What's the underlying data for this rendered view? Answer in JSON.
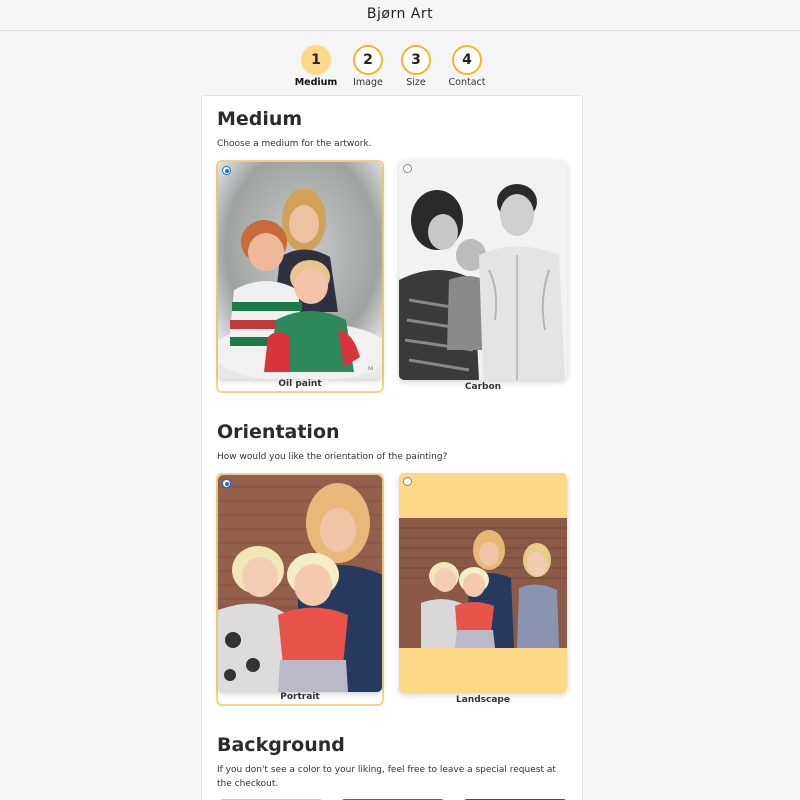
{
  "header": {
    "logo": "Bjørn Art"
  },
  "steps": [
    {
      "number": "1",
      "label": "Medium",
      "active": true
    },
    {
      "number": "2",
      "label": "Image",
      "active": false
    },
    {
      "number": "3",
      "label": "Size",
      "active": false
    },
    {
      "number": "4",
      "label": "Contact",
      "active": false
    }
  ],
  "medium": {
    "title": "Medium",
    "description": "Choose a medium for the artwork.",
    "options": [
      {
        "label": "Oil paint",
        "selected": true
      },
      {
        "label": "Carbon",
        "selected": false
      }
    ]
  },
  "orientation": {
    "title": "Orientation",
    "description": "How would you like the orientation of the painting?",
    "options": [
      {
        "label": "Portrait",
        "selected": true
      },
      {
        "label": "Landscape",
        "selected": false
      }
    ]
  },
  "background": {
    "title": "Background",
    "description": "If you don't see a color to your liking, feel free to leave a special request at the checkout.",
    "swatches": [
      "#f5c76a",
      "#2f6fb0",
      "#4a4a4a"
    ]
  },
  "colors": {
    "accent": "#f0b92b",
    "accent_light": "#fcd887",
    "selected_border": "#f6d488",
    "radio_blue": "#1a6fd6"
  }
}
